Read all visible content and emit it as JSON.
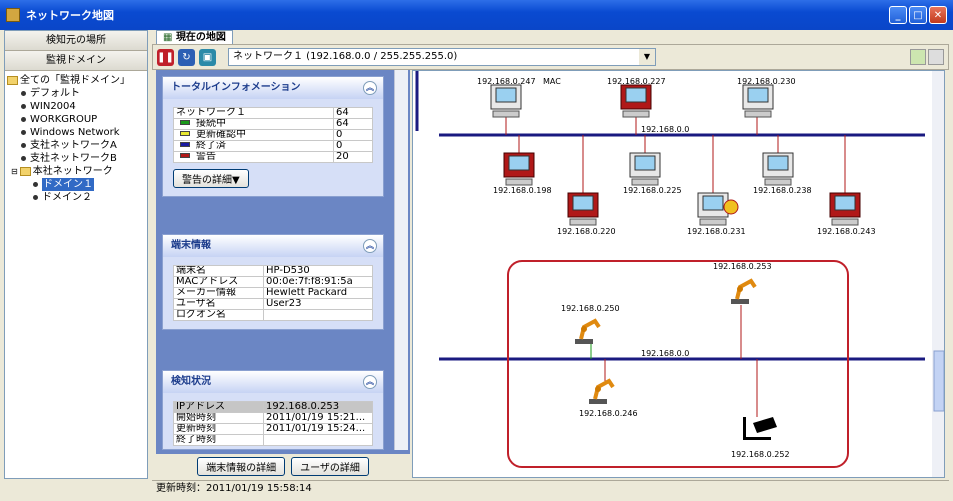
{
  "window": {
    "title": "ネットワーク地図"
  },
  "left": {
    "btn_location": "検知元の場所",
    "btn_domain": "監視ドメイン",
    "tree": {
      "root": "全ての「監視ドメイン」",
      "items": [
        "デフォルト",
        "WIN2004",
        "WORKGROUP",
        "Windows Network",
        "支社ネットワークA",
        "支社ネットワークB"
      ],
      "group": "本社ネットワーク",
      "children": [
        "ドメイン１",
        "ドメイン２"
      ]
    }
  },
  "tab": {
    "label": "現在の地図"
  },
  "toolbar": {
    "network_select": "ネットワーク１ (192.168.0.0 / 255.255.255.0)"
  },
  "total_info": {
    "title": "トータルインフォメーション",
    "rows": [
      {
        "label": "ネットワーク１",
        "value": "64",
        "color": ""
      },
      {
        "label": "接続中",
        "value": "64",
        "color": "#1a9a1a"
      },
      {
        "label": "更新確認中",
        "value": "0",
        "color": "#e8e830"
      },
      {
        "label": "終了済",
        "value": "0",
        "color": "#1a1aa0"
      },
      {
        "label": "警告",
        "value": "20",
        "color": "#b01818"
      }
    ],
    "detail_button": "警告の詳細▼"
  },
  "terminal_info": {
    "title": "端末情報",
    "rows": [
      {
        "label": "端末名",
        "value": "HP-D530"
      },
      {
        "label": "MACアドレス",
        "value": "00:0e:7f:f8:91:5a"
      },
      {
        "label": "メーカー情報",
        "value": "Hewlett Packard"
      },
      {
        "label": "ユーザ名",
        "value": "User23"
      },
      {
        "label": "ログオン名",
        "value": ""
      }
    ]
  },
  "detect_status": {
    "title": "検知状況",
    "rows": [
      {
        "label": "IPアドレス",
        "value": "192.168.0.253"
      },
      {
        "label": "開始時刻",
        "value": "2011/01/19 15:21..."
      },
      {
        "label": "更新時刻",
        "value": "2011/01/19 15:24..."
      },
      {
        "label": "終了時刻",
        "value": ""
      }
    ]
  },
  "bottom_buttons": {
    "terminal_detail": "端末情報の詳細",
    "user_detail": "ユーザの詳細"
  },
  "map": {
    "top_labels": [
      "192.168.0.247",
      "192.168.0.227",
      "192.168.0.230",
      "MAC"
    ],
    "segment1": "192.168.0.0",
    "mid_labels": [
      "192.168.0.198",
      "192.168.0.225",
      "192.168.0.238",
      "192.168.0.220",
      "192.168.0.231",
      "192.168.0.243"
    ],
    "segment2": "192.168.0.0",
    "robot_labels": [
      "192.168.0.253",
      "192.168.0.250",
      "192.168.0.246",
      "192.168.0.252"
    ]
  },
  "status": {
    "text": "更新時刻：2011/01/19 15:58:14"
  }
}
